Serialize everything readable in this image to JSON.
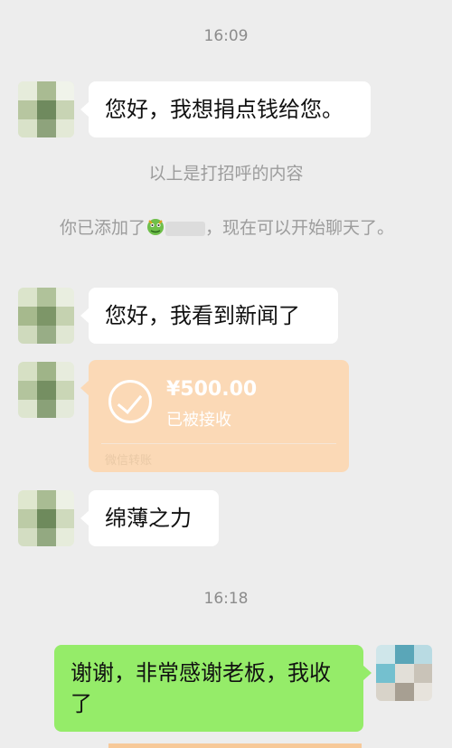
{
  "chat": {
    "time_1": "16:09",
    "msg_1": "您好，我想捐点钱给您。",
    "sys_greeting": "以上是打招呼的内容",
    "sys_added_prefix": "你已添加了",
    "sys_added_suffix": "，现在可以开始聊天了。",
    "msg_2": "您好，我看到新闻了",
    "transfer": {
      "amount": "¥500.00",
      "status": "已被接收",
      "footer": "微信转账"
    },
    "msg_3": "绵薄之力",
    "time_2": "16:18",
    "msg_4": "谢谢，非常感谢老板，我收了"
  },
  "colors": {
    "background": "#ededed",
    "bubble_incoming": "#ffffff",
    "bubble_outgoing": "#95ec69",
    "transfer_card": "#fbd9b6"
  }
}
